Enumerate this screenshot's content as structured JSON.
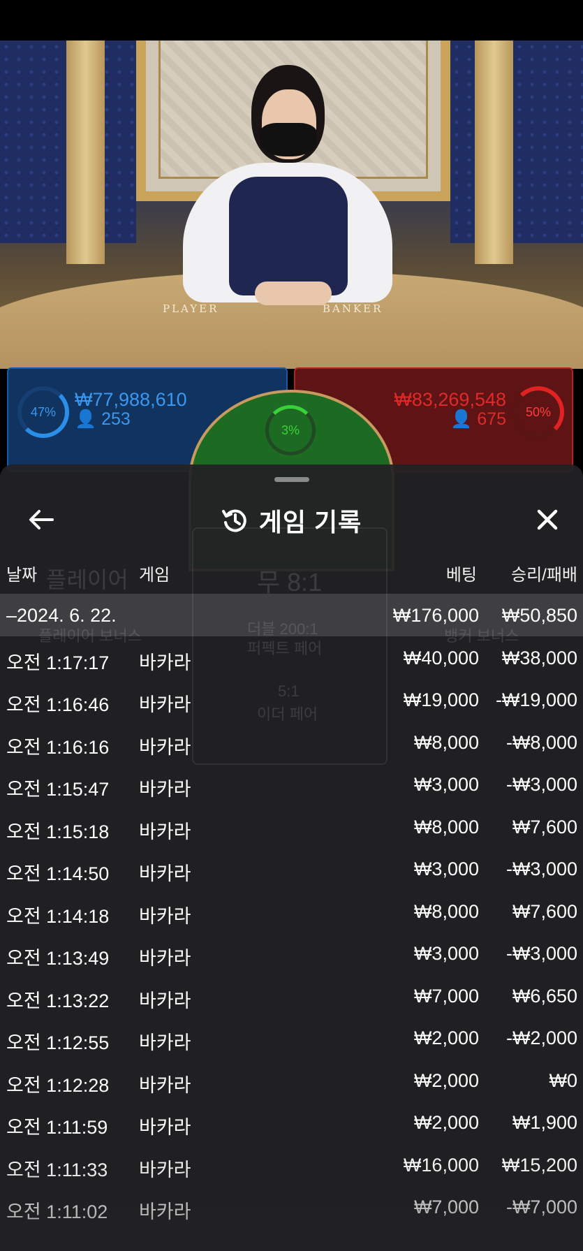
{
  "colors": {
    "player_blue": "#3b97f0",
    "banker_red": "#e02a2a",
    "tie_green": "#38d13a",
    "sheet_bg": "#222224"
  },
  "table": {
    "player_label": "PLAYER",
    "banker_label": "BANKER"
  },
  "bets": {
    "player": {
      "percent": "47%",
      "amount": "₩77,988,610",
      "users": "253"
    },
    "tie": {
      "percent": "3%"
    },
    "banker": {
      "percent": "50%",
      "amount": "₩83,269,548",
      "users": "675"
    }
  },
  "background_ghost": {
    "player_ratio": "플레이어",
    "tie_ratio": "무 8:1",
    "perfect_pair_ratio": "더블 200:1",
    "perfect_pair": "퍼펙트 페어",
    "player_bonus": "플레이어 보너스",
    "banker_bonus": "뱅커 보너스",
    "either_ratio": "5:1",
    "either_pair": "이더 페어"
  },
  "sheet": {
    "title": "게임 기록",
    "back_icon": "arrow-left-icon",
    "history_icon": "history-icon",
    "close_icon": "close-icon",
    "columns": {
      "date": "날짜",
      "game": "게임",
      "bet": "베팅",
      "result": "승리/패배"
    },
    "date_group": {
      "label": "–2024. 6. 22.",
      "bet_total": "₩176,000",
      "result_total": "₩50,850"
    },
    "rows": [
      {
        "time": "오전 1:17:17",
        "game": "바카라",
        "bet": "₩40,000",
        "result": "₩38,000"
      },
      {
        "time": "오전 1:16:46",
        "game": "바카라",
        "bet": "₩19,000",
        "result": "-₩19,000"
      },
      {
        "time": "오전 1:16:16",
        "game": "바카라",
        "bet": "₩8,000",
        "result": "-₩8,000"
      },
      {
        "time": "오전 1:15:47",
        "game": "바카라",
        "bet": "₩3,000",
        "result": "-₩3,000"
      },
      {
        "time": "오전 1:15:18",
        "game": "바카라",
        "bet": "₩8,000",
        "result": "₩7,600"
      },
      {
        "time": "오전 1:14:50",
        "game": "바카라",
        "bet": "₩3,000",
        "result": "-₩3,000"
      },
      {
        "time": "오전 1:14:18",
        "game": "바카라",
        "bet": "₩8,000",
        "result": "₩7,600"
      },
      {
        "time": "오전 1:13:49",
        "game": "바카라",
        "bet": "₩3,000",
        "result": "-₩3,000"
      },
      {
        "time": "오전 1:13:22",
        "game": "바카라",
        "bet": "₩7,000",
        "result": "₩6,650"
      },
      {
        "time": "오전 1:12:55",
        "game": "바카라",
        "bet": "₩2,000",
        "result": "-₩2,000"
      },
      {
        "time": "오전 1:12:28",
        "game": "바카라",
        "bet": "₩2,000",
        "result": "₩0"
      },
      {
        "time": "오전 1:11:59",
        "game": "바카라",
        "bet": "₩2,000",
        "result": "₩1,900"
      },
      {
        "time": "오전 1:11:33",
        "game": "바카라",
        "bet": "₩16,000",
        "result": "₩15,200"
      },
      {
        "time": "오전 1:11:02",
        "game": "바카라",
        "bet": "₩7,000",
        "result": "-₩7,000"
      }
    ]
  }
}
